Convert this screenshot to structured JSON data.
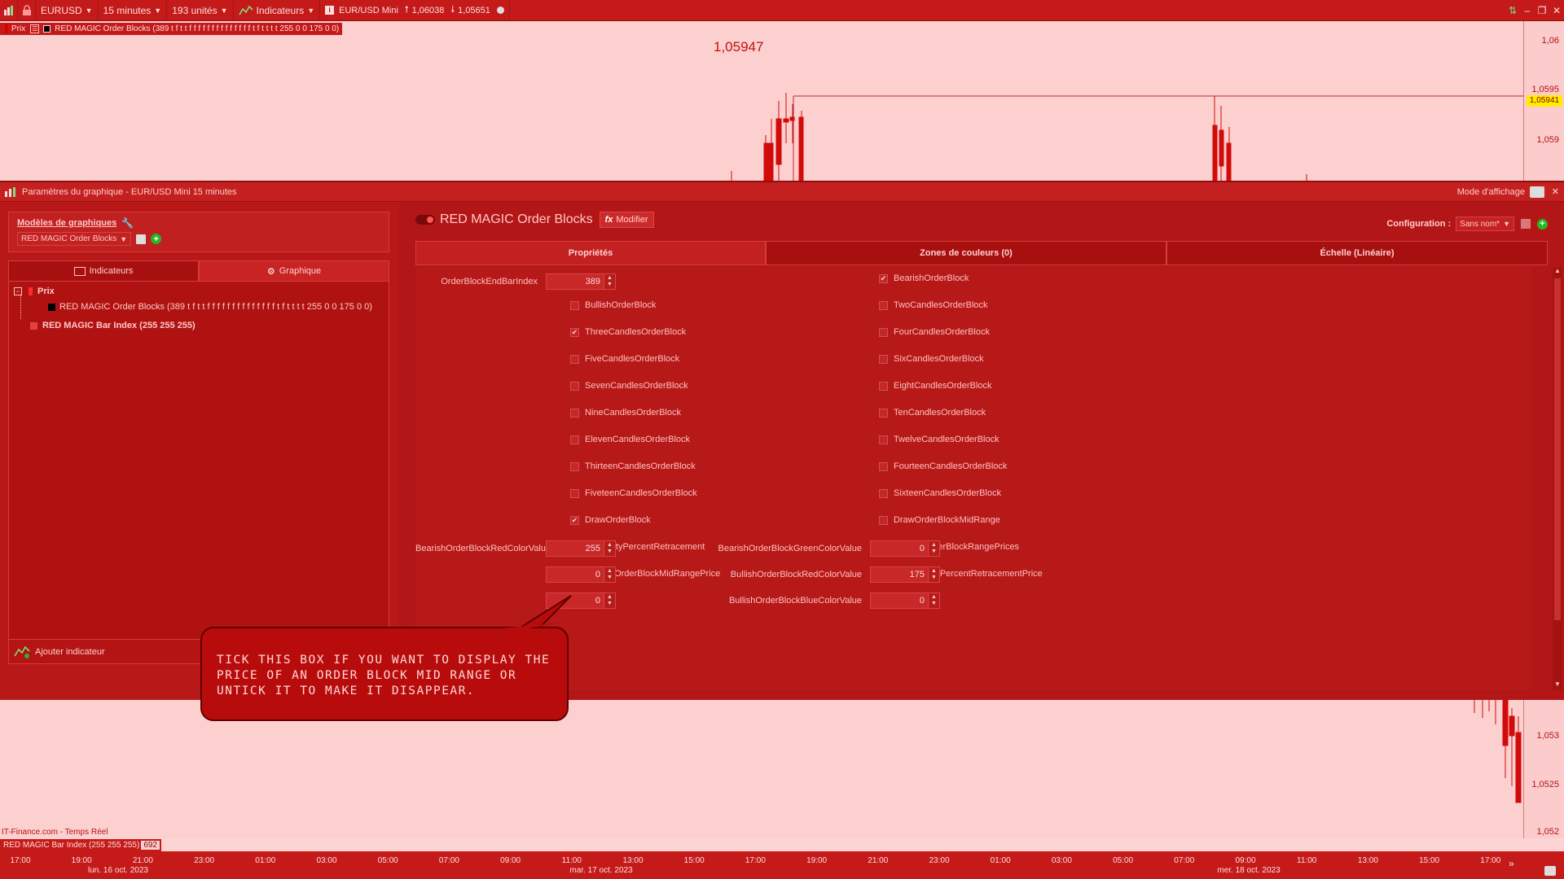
{
  "toolbar": {
    "symbol": "EURUSD",
    "timeframe": "15 minutes",
    "units": "193 unités",
    "indicators": "Indicateurs",
    "instrument": "EUR/USD Mini",
    "ask": "1,06038",
    "bid": "1,05651"
  },
  "chart": {
    "legend_price": "Prix",
    "legend_indicator": "RED MAGIC Order Blocks (389 t f t t f f f f f f f f f f f f f f t f t t t t 255 0 0 175 0 0)",
    "big_price": "1,05947",
    "price_tag": "1,05941",
    "top_axis": [
      "1,06",
      "1,0595",
      "1,059"
    ],
    "bottom_axis": [
      "1,053",
      "1,0525",
      "1,052"
    ],
    "source": "IT-Finance.com - Temps Réel",
    "bar_index_label": "RED MAGIC Bar Index (255 255 255)",
    "bar_index_value": "692",
    "times": [
      "17:00",
      "19:00",
      "21:00",
      "23:00",
      "01:00",
      "03:00",
      "05:00",
      "07:00",
      "09:00",
      "11:00",
      "13:00",
      "15:00",
      "17:00",
      "19:00",
      "21:00",
      "23:00",
      "01:00",
      "03:00",
      "05:00",
      "07:00",
      "09:00",
      "11:00",
      "13:00",
      "15:00",
      "17:00"
    ],
    "dates": [
      "lun. 16 oct. 2023",
      "mar. 17 oct. 2023",
      "mer. 18 oct. 2023"
    ]
  },
  "settings": {
    "title": "Paramètres du graphique - EUR/USD Mini 15 minutes",
    "display_mode": "Mode d'affichage",
    "models_label": "Modèles de graphiques",
    "model_selected": "RED MAGIC Order Blocks",
    "tab_indicators": "Indicateurs",
    "tab_chart": "Graphique",
    "tree_root": "Prix",
    "tree_child": "RED MAGIC Order Blocks (389 t f t t f f f f f f f f f f f f f f t f t t t t 255 0 0 175 0 0)",
    "tree_second": "RED MAGIC Bar Index (255 255 255)",
    "add_indicator": "Ajouter indicateur",
    "indicator_name": "RED MAGIC Order Blocks",
    "modify": "Modifier",
    "config_label": "Configuration :",
    "config_value": "Sans nom*",
    "tab_properties": "Propriétés",
    "tab_zones": "Zones de couleurs (0)",
    "tab_scale": "Échelle (Linéaire)",
    "end_bar_label": "OrderBlockEndBarIndex",
    "end_bar_value": "389",
    "checkboxes_left": [
      {
        "label": "BullishOrderBlock",
        "checked": false
      },
      {
        "label": "ThreeCandlesOrderBlock",
        "checked": true
      },
      {
        "label": "FiveCandlesOrderBlock",
        "checked": false
      },
      {
        "label": "SevenCandlesOrderBlock",
        "checked": false
      },
      {
        "label": "NineCandlesOrderBlock",
        "checked": false
      },
      {
        "label": "ElevenCandlesOrderBlock",
        "checked": false
      },
      {
        "label": "ThirteenCandlesOrderBlock",
        "checked": false
      },
      {
        "label": "FiveteenCandlesOrderBlock",
        "checked": false
      },
      {
        "label": "DrawOrderBlock",
        "checked": true
      },
      {
        "label": "DrawFiftyPercentRetracement",
        "checked": true
      },
      {
        "label": "DisplayOrderBlockMidRangePrice",
        "checked": true
      }
    ],
    "checkboxes_right": [
      {
        "label": "BearishOrderBlock",
        "checked": true
      },
      {
        "label": "TwoCandlesOrderBlock",
        "checked": false
      },
      {
        "label": "FourCandlesOrderBlock",
        "checked": false
      },
      {
        "label": "SixCandlesOrderBlock",
        "checked": false
      },
      {
        "label": "EightCandlesOrderBlock",
        "checked": false
      },
      {
        "label": "TenCandlesOrderBlock",
        "checked": false
      },
      {
        "label": "TwelveCandlesOrderBlock",
        "checked": false
      },
      {
        "label": "FourteenCandlesOrderBlock",
        "checked": false
      },
      {
        "label": "SixteenCandlesOrderBlock",
        "checked": false
      },
      {
        "label": "DrawOrderBlockMidRange",
        "checked": false
      },
      {
        "label": "DisplayOrderBlockRangePrices",
        "checked": true
      },
      {
        "label": "DisplayFiftyPercentRetracementPrice",
        "checked": true
      }
    ],
    "numeric_left": [
      {
        "label": "BearishOrderBlockRedColorValue",
        "value": "255"
      },
      {
        "label": "",
        "value": "0"
      },
      {
        "label": "",
        "value": "0"
      }
    ],
    "numeric_right": [
      {
        "label": "BearishOrderBlockGreenColorValue",
        "value": "0"
      },
      {
        "label": "BullishOrderBlockRedColorValue",
        "value": "175"
      },
      {
        "label": "BullishOrderBlockBlueColorValue",
        "value": "0"
      }
    ]
  },
  "callout": {
    "text": "TICK THIS BOX IF YOU WANT TO DISPLAY THE PRICE OF AN ORDER BLOCK MID RANGE OR UNTICK IT TO MAKE IT DISAPPEAR."
  },
  "colors": {
    "panel": "#b81818",
    "chart_bg": "#fdd0d0",
    "candle": "#d10a0a",
    "price_tag": "#ffee00"
  }
}
